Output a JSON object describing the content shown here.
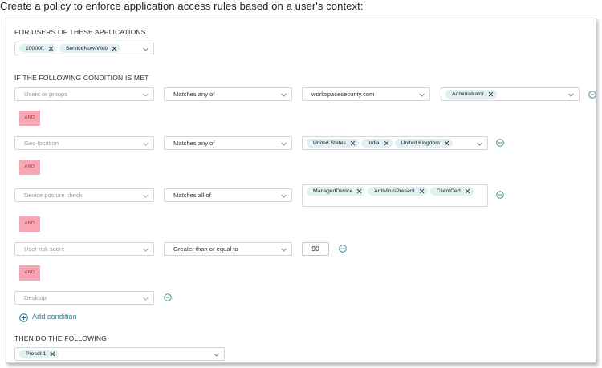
{
  "heading": "Create a policy to enforce application access rules based on a user's context:",
  "apps": {
    "label": "FOR USERS OF THESE APPLICATIONS",
    "tags": [
      "10000ft",
      "ServiceNow-Web"
    ]
  },
  "conditions": {
    "label": "IF THE FOLLOWING CONDITION IS MET",
    "and_label": "AND",
    "rows": [
      {
        "field": "Users or groups",
        "operator": "Matches any of",
        "value": "workspacesecurity.com",
        "tags": [
          "Administrator"
        ]
      },
      {
        "field": "Geo-location",
        "operator": "Matches any of",
        "tags": [
          "United States",
          "India",
          "United Kingdom"
        ]
      },
      {
        "field": "Device posture check",
        "operator": "Matches all of",
        "tags": [
          "ManagedDevice",
          "AntiVirusPresent",
          "ClientCert"
        ]
      },
      {
        "field": "User risk score",
        "operator": "Greater than or equal to",
        "value": "90"
      },
      {
        "field": "Desktop"
      }
    ],
    "add_label": "Add condition"
  },
  "actions": {
    "label": "THEN DO THE FOLLOWING",
    "tags": [
      "Preset 1"
    ]
  },
  "colors": {
    "tag_bg": "#dff1f2",
    "and_bg": "#f7a7b3",
    "and_text": "#c2263a",
    "accent": "#1b7f93"
  },
  "icons": {
    "chevron": "chevron-down-icon",
    "remove_tag": "close-icon",
    "remove_row": "minus-circle-icon",
    "add": "plus-circle-icon"
  }
}
